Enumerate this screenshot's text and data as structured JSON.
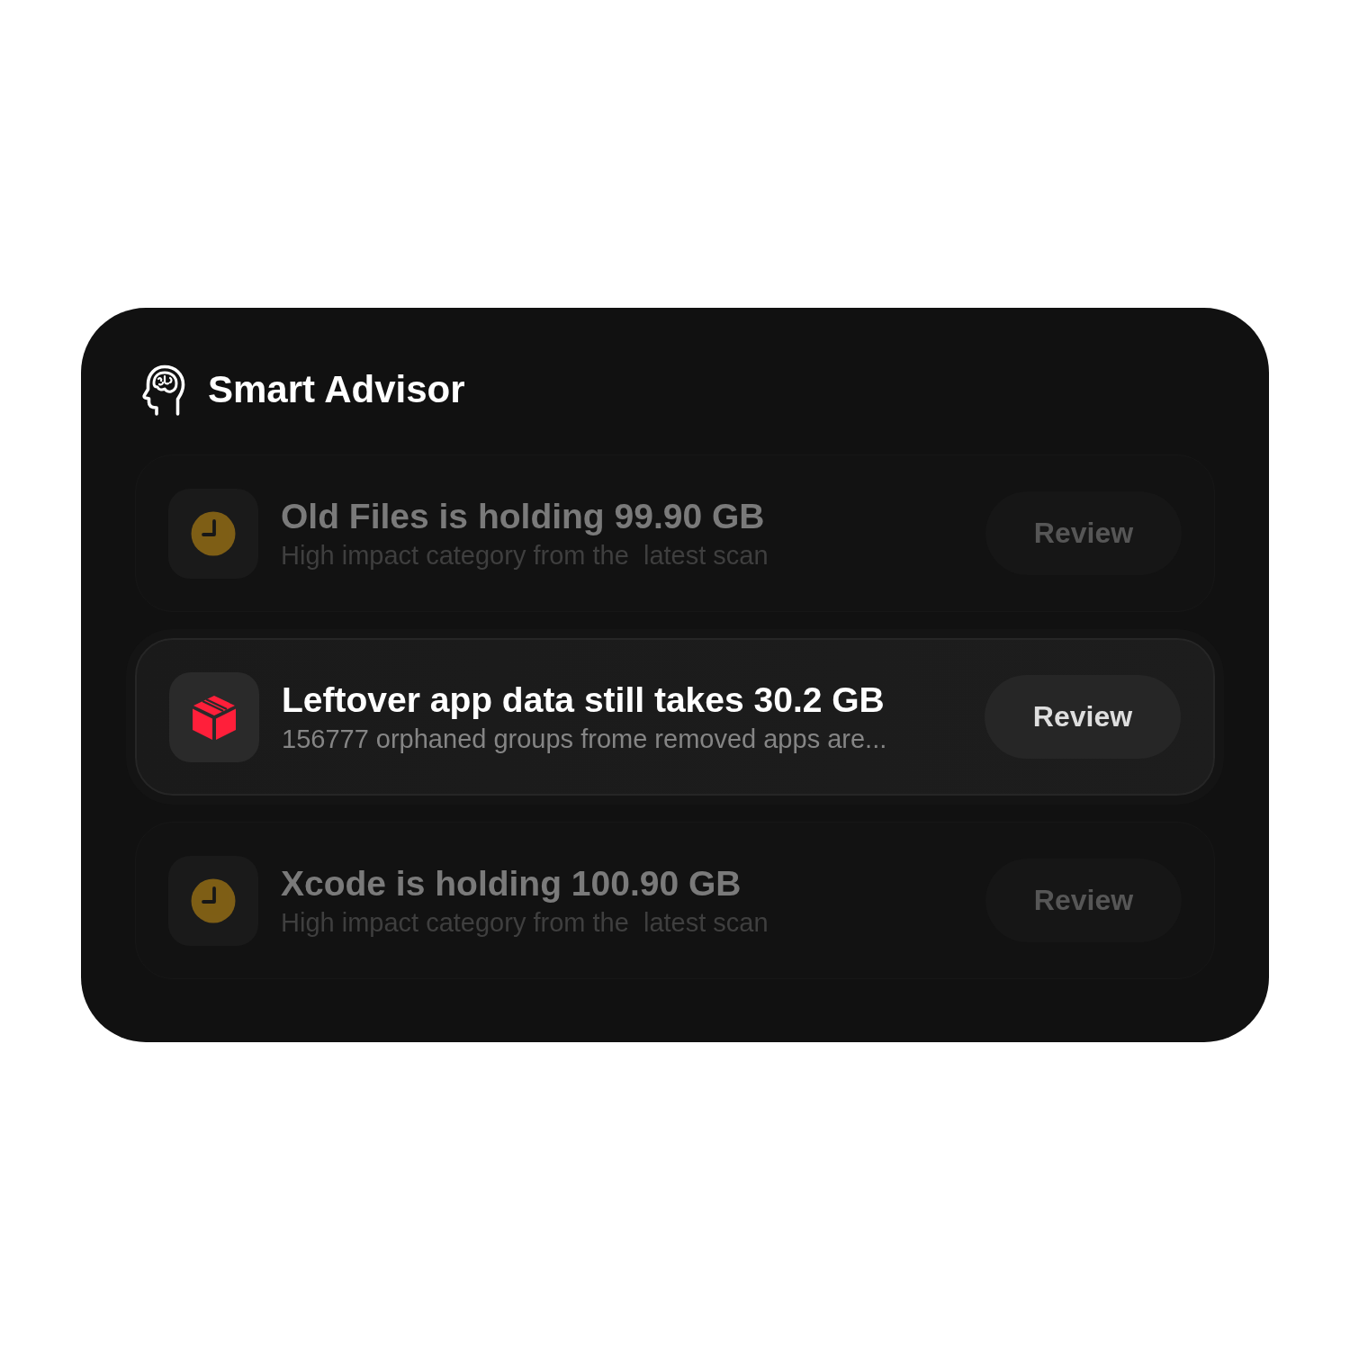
{
  "header": {
    "title": "Smart Advisor"
  },
  "rows": [
    {
      "kind": "clock",
      "selected": false,
      "title": "Old Files is holding 99.90 GB",
      "description": "High impact category from the  latest scan",
      "button": "Review"
    },
    {
      "kind": "box",
      "selected": true,
      "title": "Leftover app data still takes 30.2 GB",
      "description": "156777 orphaned groups frome removed apps are...",
      "button": "Review"
    },
    {
      "kind": "clock",
      "selected": false,
      "title": "Xcode is holding 100.90 GB",
      "description": "High impact category from the  latest scan",
      "button": "Review"
    }
  ]
}
